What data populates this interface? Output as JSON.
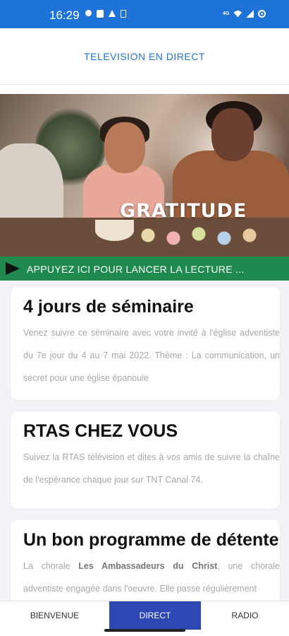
{
  "status_bar": {
    "time": "16:29",
    "left_icons": [
      "messenger-icon",
      "facebook-icon",
      "warning-icon",
      "sim-icon"
    ],
    "network_label": "4G",
    "right_icons": [
      "wifi-icon",
      "signal-icon",
      "target-icon"
    ],
    "background_color": "#1e73d8"
  },
  "header": {
    "title": "TELEVISION EN DIRECT"
  },
  "video": {
    "caption": "GRATITUDE"
  },
  "play_bar": {
    "label": "APPUYEZ ICI POUR LANCER LA LECTURE ...",
    "background_color": "#1f8a4e"
  },
  "cards": [
    {
      "title": "4 jours de séminaire",
      "body": "Venez suivre ce séminaire avec votre invité à l'église adventiste du 7e jour du 4 au 7 mai 2022. Thème : La communication, un secret pour une église épanouie"
    },
    {
      "title": "RTAS CHEZ VOUS",
      "body": "Suivez la RTAS télévision et dites à vos amis de suivre la chaîne de l'espérance chaque jour sur TNT Canal 74."
    },
    {
      "title": "Un bon programme de détente",
      "body_prefix": "La chorale ",
      "body_bold": "Les Ambassadeurs du Christ",
      "body_suffix": ", une chorale adventiste engagée dans l'oeuvre. Elle passe régulièrement"
    }
  ],
  "bottom_nav": {
    "items": [
      {
        "label": "BIENVENUE",
        "active": false
      },
      {
        "label": "DIRECT",
        "active": true
      },
      {
        "label": "RADIO",
        "active": false
      }
    ],
    "active_color": "#2d47b5"
  }
}
